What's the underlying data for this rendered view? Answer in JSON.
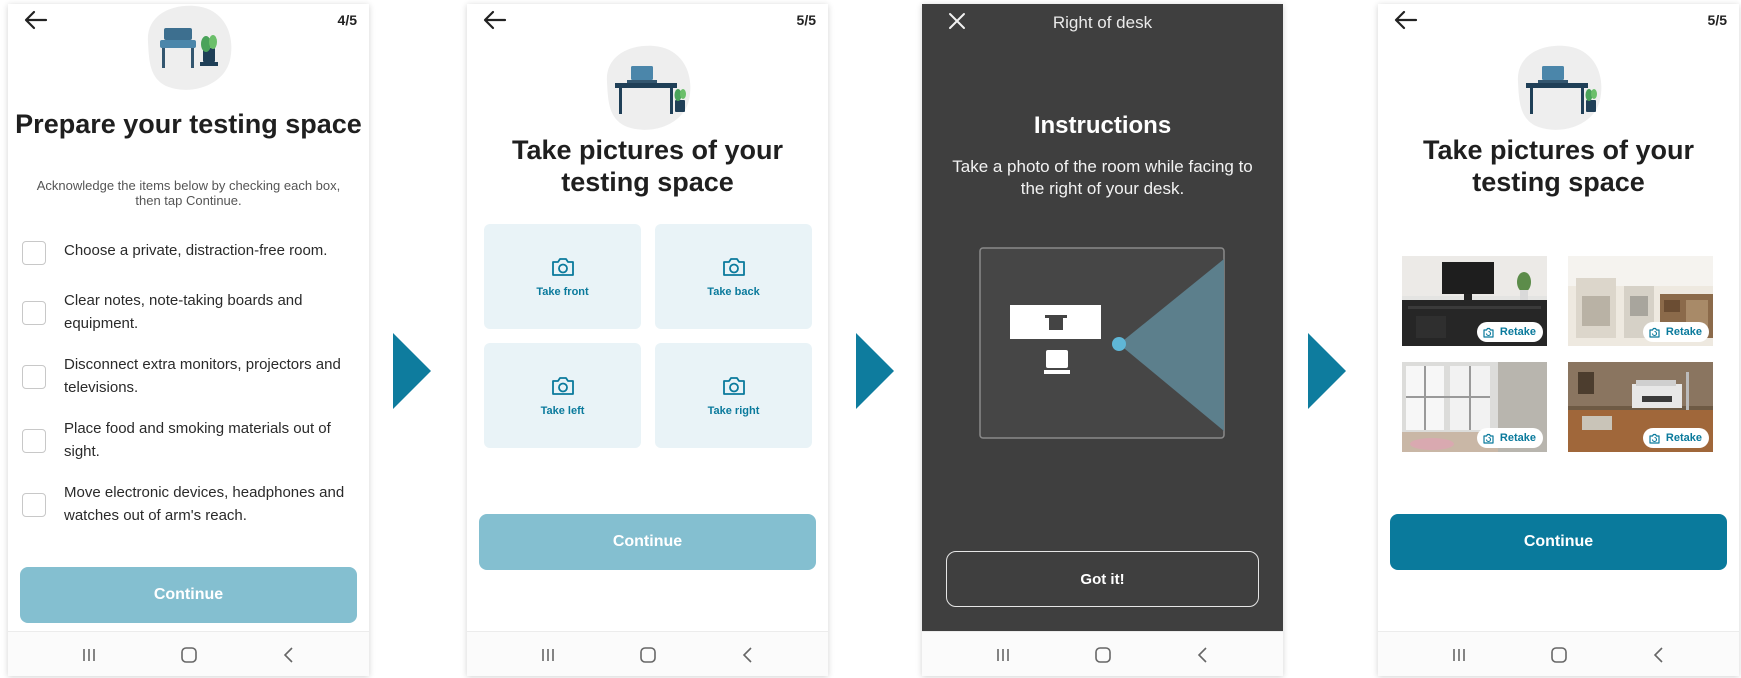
{
  "screen1": {
    "step": "4/5",
    "title": "Prepare your testing space",
    "subtitle": "Acknowledge the items below by checking each box, then tap Continue.",
    "items": [
      {
        "label": "Choose a private, distraction-free room."
      },
      {
        "label": "Clear notes, note-taking boards and equipment."
      },
      {
        "label": "Disconnect extra monitors, projectors and televisions."
      },
      {
        "label": "Place food and smoking materials out of sight."
      },
      {
        "label": "Move electronic devices, headphones and watches out of arm's reach."
      }
    ],
    "continue_label": "Continue"
  },
  "screen2": {
    "step": "5/5",
    "title": "Take pictures of your testing space",
    "tiles": [
      {
        "label": "Take front"
      },
      {
        "label": "Take back"
      },
      {
        "label": "Take left"
      },
      {
        "label": "Take right"
      }
    ],
    "continue_label": "Continue"
  },
  "screen3": {
    "header": "Right of desk",
    "title": "Instructions",
    "text": "Take a photo of the room while facing to the right of your desk.",
    "button_label": "Got it!"
  },
  "screen4": {
    "step": "5/5",
    "title": "Take pictures of your testing space",
    "retake_label": "Retake",
    "continue_label": "Continue"
  },
  "icons": {
    "back": "arrow-left-icon",
    "close": "close-icon",
    "camera": "camera-icon",
    "retake": "retake-camera-icon",
    "nav_recents": "recents-icon",
    "nav_home": "home-icon",
    "nav_back": "nav-back-icon"
  },
  "colors": {
    "accent": "#0a7a9c",
    "accent_disabled": "#84bfd0",
    "arrow": "#0e7c9e",
    "tile_bg": "#e9f3f7",
    "camera_bg": "#3f3f3f"
  }
}
